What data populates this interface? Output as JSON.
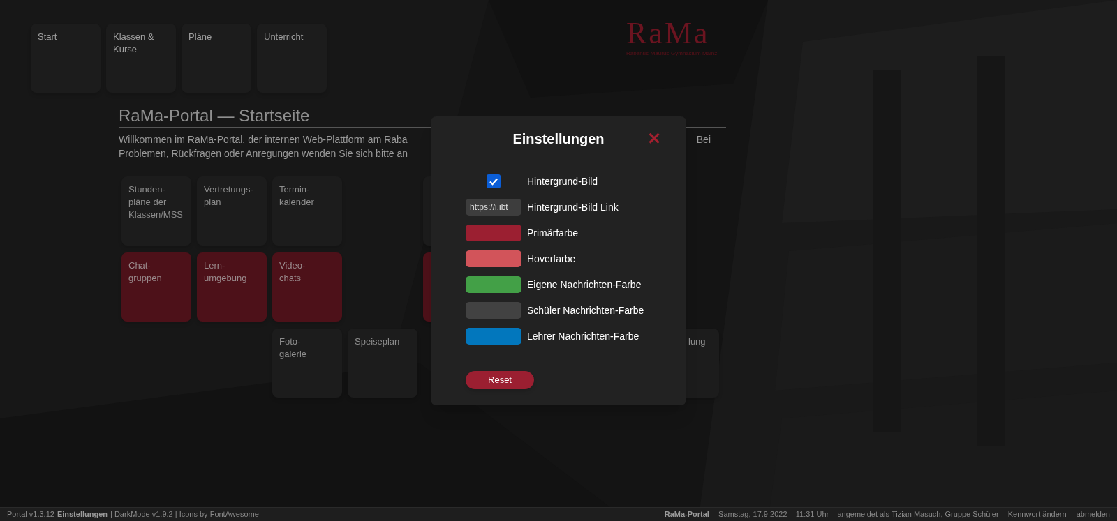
{
  "nav": [
    {
      "label": "Start"
    },
    {
      "label": "Klassen &\nKurse"
    },
    {
      "label": "Pläne"
    },
    {
      "label": "Unterricht"
    }
  ],
  "logo": {
    "title": "RaMa",
    "subtitle": "Rabanus-Maurus-Gymnasium Mainz"
  },
  "page": {
    "title": "RaMa-Portal — Startseite",
    "intro_lines": [
      {
        "left": "Willkommen im RaMa-Portal, der internen Web-Plattform am Raba",
        "right": "Bei"
      },
      {
        "left": "Problemen, Rückfragen oder Anregungen wenden Sie sich bitte an"
      }
    ]
  },
  "tile_rows": [
    [
      {
        "kind": "plain",
        "label": "Stunden-\npläne der\nKlassen/MSS"
      },
      {
        "kind": "plain",
        "label": "Vertretungs-\nplan"
      },
      {
        "kind": "plain",
        "label": "Termin-\nkalender"
      },
      {
        "kind": "empty"
      },
      {
        "kind": "plain"
      }
    ],
    [
      {
        "kind": "accent",
        "label": "Chat-\ngruppen"
      },
      {
        "kind": "accent",
        "label": "Lern-\numgebung"
      },
      {
        "kind": "accent",
        "label": "Video-\nchats"
      },
      {
        "kind": "empty"
      },
      {
        "kind": "accent"
      }
    ],
    [
      {
        "kind": "empty"
      },
      {
        "kind": "empty"
      },
      {
        "kind": "plain",
        "label": "Foto-\ngalerie"
      },
      {
        "kind": "plain",
        "label": "Speiseplan"
      },
      {
        "kind": "empty"
      },
      {
        "kind": "empty"
      },
      {
        "kind": "empty"
      },
      {
        "kind": "plain",
        "label": "lung"
      }
    ]
  ],
  "settings": {
    "title": "Einstellungen",
    "close": "✕",
    "rows": [
      {
        "kind": "checkbox",
        "checked": true,
        "label": "Hintergrund-Bild"
      },
      {
        "kind": "text",
        "value": "https://i.ibt",
        "label": "Hintergrund-Bild Link"
      },
      {
        "kind": "color",
        "color": "#9b1f31",
        "label": "Primärfarbe"
      },
      {
        "kind": "color",
        "color": "#d2545a",
        "label": "Hoverfarbe"
      },
      {
        "kind": "color",
        "color": "#43a047",
        "label": "Eigene Nachrichten-Farbe"
      },
      {
        "kind": "color",
        "color": "#424242",
        "label": "Schüler Nachrichten-Farbe"
      },
      {
        "kind": "color",
        "color": "#0277bd",
        "label": "Lehrer Nachrichten-Farbe"
      }
    ],
    "reset": "Reset"
  },
  "status_bar": {
    "left": [
      {
        "kind": "plain",
        "text": "Portal v1.3.12"
      },
      {
        "kind": "link",
        "text": "Einstellungen"
      },
      {
        "kind": "plain",
        "text": "| DarkMode v1.9.2 | Icons by FontAwesome"
      }
    ],
    "right": [
      {
        "kind": "bold",
        "text": "RaMa-Portal"
      },
      {
        "kind": "plain",
        "text": "– Samstag, 17.9.2022 – 11:31 Uhr – angemeldet als Tizian Masuch, Gruppe Schüler –"
      },
      {
        "kind": "link",
        "text": "Kennwort ändern"
      },
      {
        "kind": "plain",
        "text": "–"
      },
      {
        "kind": "link",
        "text": "abmelden"
      }
    ]
  }
}
